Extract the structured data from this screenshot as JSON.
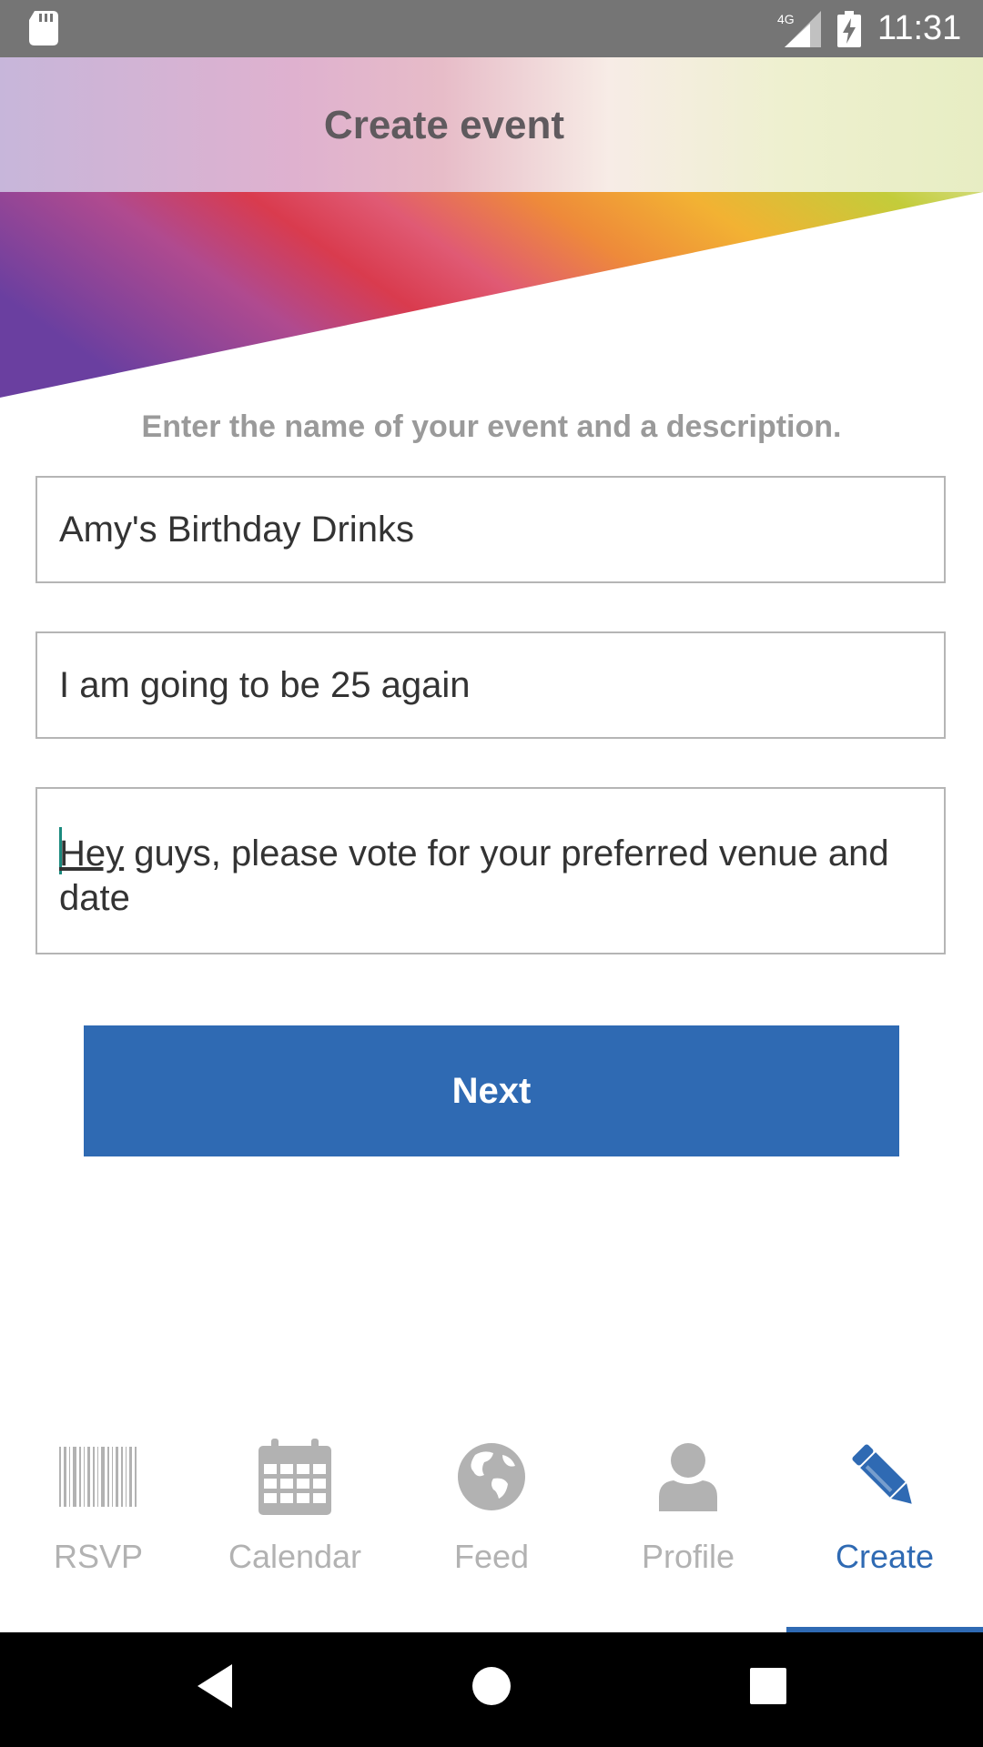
{
  "status_bar": {
    "network": "4G",
    "time": "11:31"
  },
  "header": {
    "title": "Create event"
  },
  "form": {
    "instruction": "Enter the name of your event and a description.",
    "event_name": "Amy's Birthday Drinks",
    "subtitle": "I am going to be 25 again",
    "description_first_word": "Hey",
    "description_rest": " guys, please vote for your preferred venue and date"
  },
  "next_button": {
    "label": "Next"
  },
  "tabs": [
    {
      "label": "RSVP",
      "icon": "barcode-icon",
      "active": false
    },
    {
      "label": "Calendar",
      "icon": "calendar-icon",
      "active": false
    },
    {
      "label": "Feed",
      "icon": "globe-icon",
      "active": false
    },
    {
      "label": "Profile",
      "icon": "person-icon",
      "active": false
    },
    {
      "label": "Create",
      "icon": "pencil-icon",
      "active": true
    }
  ],
  "colors": {
    "accent": "#2f6ab3",
    "inactive_tab": "#b2b2b2",
    "status_bar": "#757575",
    "caret": "#1b8a7e"
  }
}
